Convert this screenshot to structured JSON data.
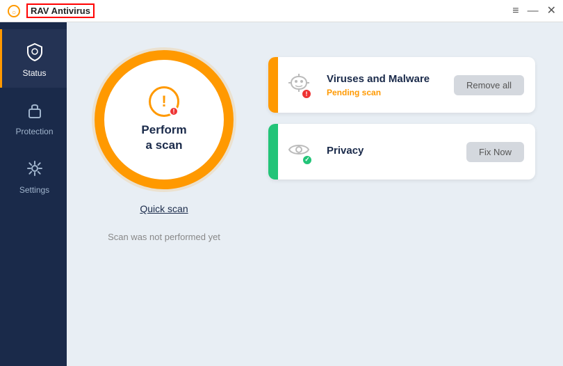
{
  "titleBar": {
    "title": "RAV Antivirus",
    "logoSymbol": "○",
    "menuBtn": "≡",
    "minimizeBtn": "—",
    "closeBtn": "✕"
  },
  "sidebar": {
    "items": [
      {
        "id": "status",
        "label": "Status",
        "icon": "shield",
        "active": true
      },
      {
        "id": "protection",
        "label": "Protection",
        "icon": "lock",
        "active": false
      },
      {
        "id": "settings",
        "label": "Settings",
        "icon": "gear",
        "active": false
      }
    ]
  },
  "scanPanel": {
    "mainText1": "Perform",
    "mainText2": "a scan",
    "quickScanLabel": "Quick scan",
    "statusText": "Scan was not performed yet"
  },
  "cards": [
    {
      "id": "viruses",
      "accentColor": "orange",
      "title": "Viruses and Malware",
      "subtitle": "Pending scan",
      "subtitleColor": "orange",
      "actionLabel": "Remove all"
    },
    {
      "id": "privacy",
      "accentColor": "green",
      "title": "Privacy",
      "subtitle": "",
      "subtitleColor": "green",
      "actionLabel": "Fix Now"
    }
  ]
}
